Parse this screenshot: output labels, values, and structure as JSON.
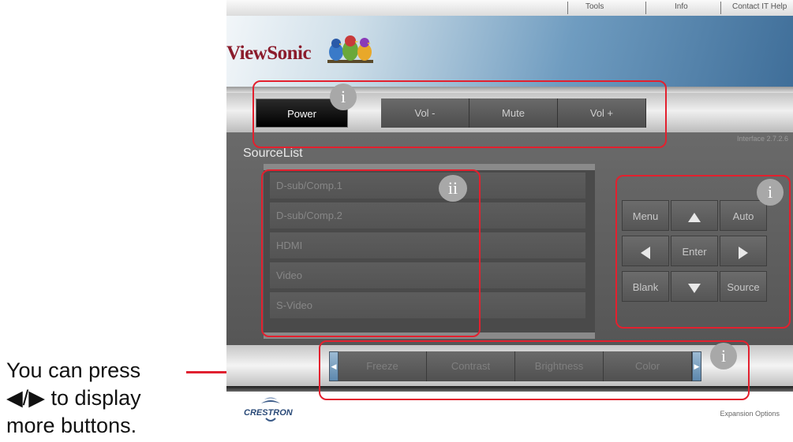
{
  "annotation": {
    "lines": [
      "You can press",
      "◀/▶ to display",
      "more buttons."
    ]
  },
  "top_menu": {
    "items": [
      "Tools",
      "Info",
      "Contact IT Help"
    ]
  },
  "brand": {
    "logo_text": "ViewSonic"
  },
  "toolbar": {
    "power_label": "Power",
    "vol_down_label": "Vol -",
    "mute_label": "Mute",
    "vol_up_label": "Vol +"
  },
  "version_text": "Interface 2.7.2.6",
  "source_list": {
    "title": "SourceList",
    "items": [
      "D-sub/Comp.1",
      "D-sub/Comp.2",
      "HDMI",
      "Video",
      "S-Video"
    ]
  },
  "keypad": {
    "menu_label": "Menu",
    "auto_label": "Auto",
    "enter_label": "Enter",
    "blank_label": "Blank",
    "source_label": "Source"
  },
  "function_bar": {
    "buttons": [
      "Freeze",
      "Contrast",
      "Brightness",
      "Color"
    ]
  },
  "footer": {
    "partner_logo_text": "CRESTRON",
    "expansion_label": "Expansion Options"
  },
  "callouts": {
    "badge_i": "i",
    "badge_ii": "ii"
  },
  "colors": {
    "highlight": "#e3202e",
    "brand_text": "#8b1c2c",
    "scroll_arrow": "#5d88ad"
  }
}
